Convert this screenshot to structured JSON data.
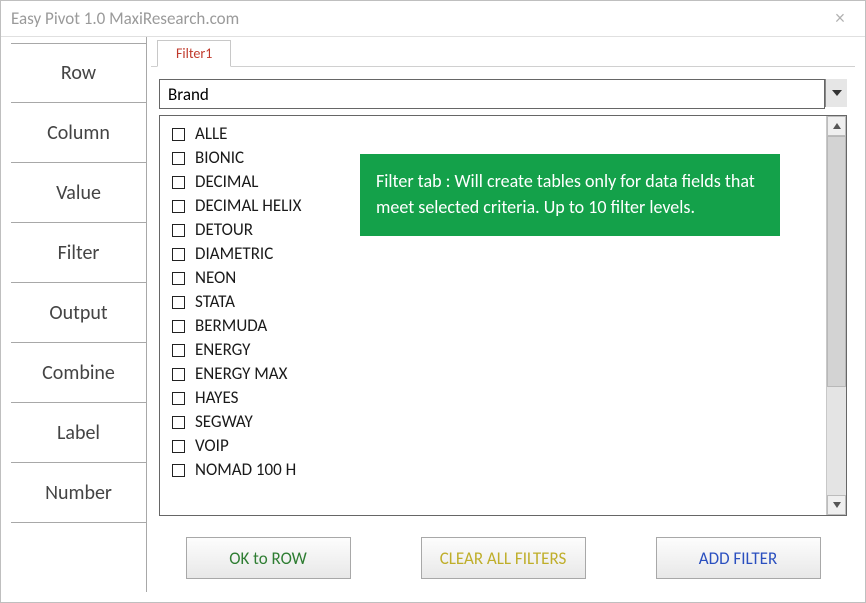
{
  "window": {
    "title": "Easy Pivot 1.0  MaxiResearch.com",
    "close_glyph": "×"
  },
  "sidebar": {
    "items": [
      {
        "label": "Row"
      },
      {
        "label": "Column"
      },
      {
        "label": "Value"
      },
      {
        "label": "Filter"
      },
      {
        "label": "Output"
      },
      {
        "label": "Combine"
      },
      {
        "label": "Label"
      },
      {
        "label": "Number"
      }
    ]
  },
  "tabs": [
    {
      "label": "Filter1"
    }
  ],
  "filter": {
    "dropdown_value": "Brand",
    "items": [
      "ALLE",
      "BIONIC",
      "DECIMAL",
      "DECIMAL HELIX",
      "DETOUR",
      "DIAMETRIC",
      "NEON",
      "STATA",
      "BERMUDA",
      "ENERGY",
      "ENERGY MAX",
      "HAYES",
      "SEGWAY",
      "VOIP",
      "NOMAD 100 H"
    ]
  },
  "callout": {
    "text": "Filter tab : Will create tables only for data fields that meet selected criteria. Up to 10 filter levels."
  },
  "buttons": {
    "ok_label": "OK to ROW",
    "clear_label": "CLEAR ALL FILTERS",
    "add_label": "ADD FILTER"
  }
}
